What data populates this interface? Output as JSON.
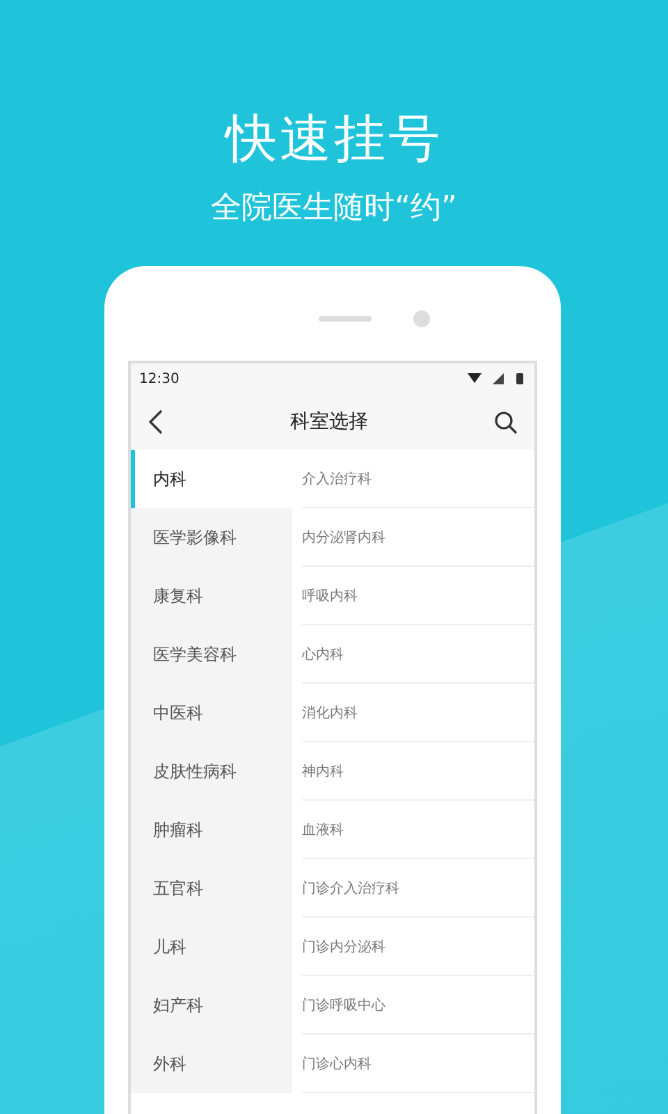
{
  "headline": "快速挂号",
  "subtitle": "全院医生随时“约”",
  "status_bar": {
    "time": "12:30"
  },
  "nav": {
    "title": "科室选择"
  },
  "departments": [
    {
      "label": "内科",
      "selected": true
    },
    {
      "label": "医学影像科",
      "selected": false
    },
    {
      "label": "康复科",
      "selected": false
    },
    {
      "label": "医学美容科",
      "selected": false
    },
    {
      "label": "中医科",
      "selected": false
    },
    {
      "label": "皮肤性病科",
      "selected": false
    },
    {
      "label": "肿瘤科",
      "selected": false
    },
    {
      "label": "五官科",
      "selected": false
    },
    {
      "label": "儿科",
      "selected": false
    },
    {
      "label": "妇产科",
      "selected": false
    },
    {
      "label": "外科",
      "selected": false
    }
  ],
  "sub_departments": [
    "介入治疗科",
    "内分泌肾内科",
    "呼吸内科",
    "心内科",
    "消化内科",
    "神内科",
    "血液科",
    "门诊介入治疗科",
    "门诊内分泌科",
    "门诊呼吸中心",
    "门诊心内科"
  ]
}
